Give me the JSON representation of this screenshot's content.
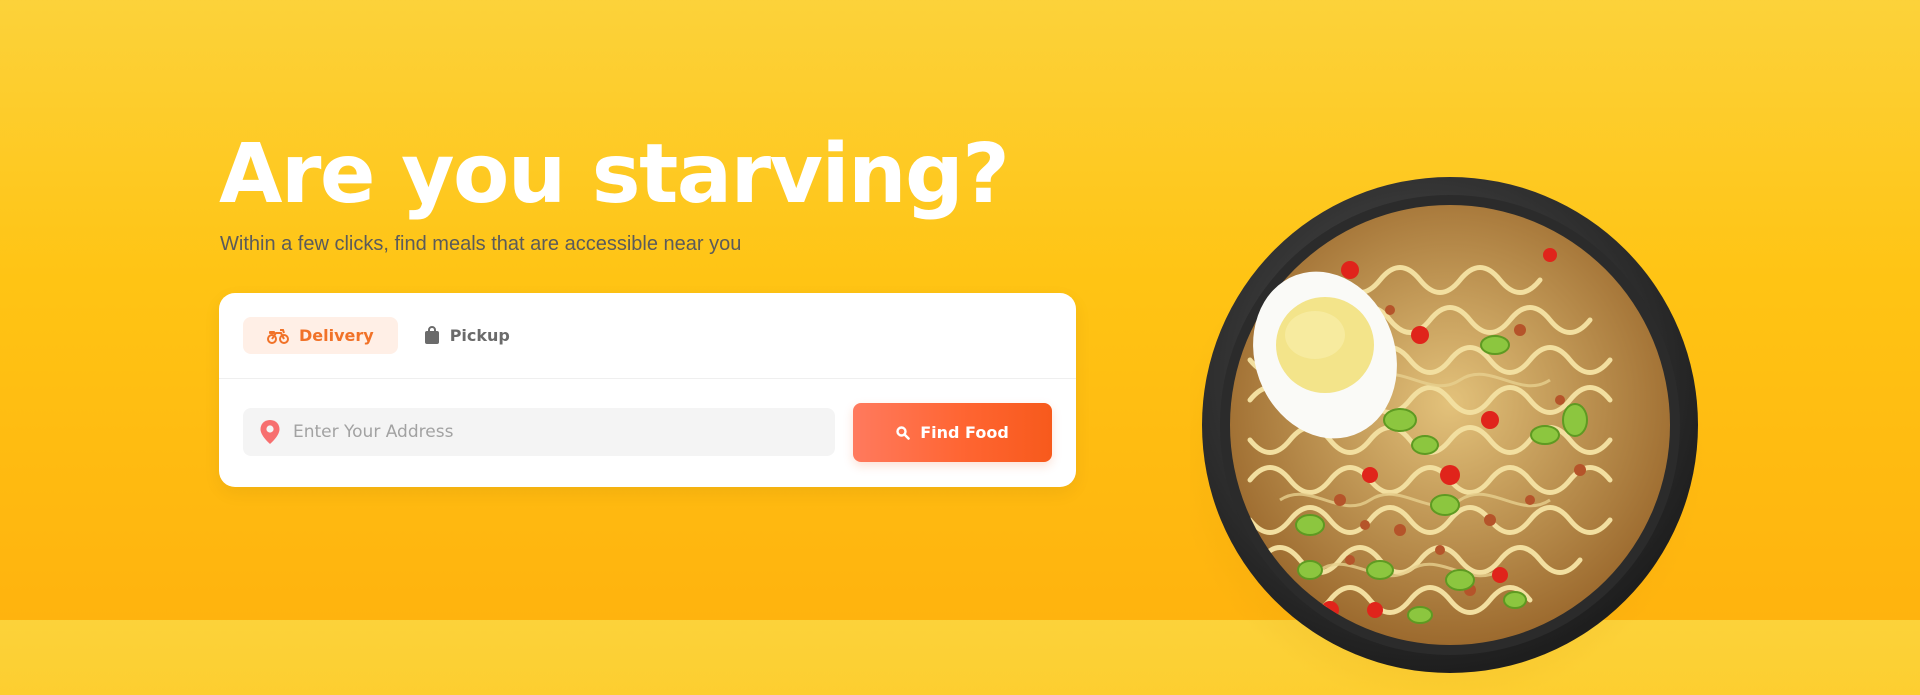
{
  "hero": {
    "title": "Are you starving?",
    "subtitle": "Within a few clicks, find meals that are accessible near you"
  },
  "search": {
    "tabs": [
      {
        "label": "Delivery",
        "icon": "motorcycle-icon",
        "active": true
      },
      {
        "label": "Pickup",
        "icon": "shopping-bag-icon",
        "active": false
      }
    ],
    "address_placeholder": "Enter Your Address",
    "address_value": "",
    "find_label": "Find Food",
    "find_icon": "search-icon"
  },
  "image": {
    "subject": "bowl-of-ramen-noodles",
    "icon": "food-image"
  },
  "colors": {
    "accent": "#F17228",
    "accent_soft": "#FFEFE6",
    "button_start": "#FF7A5E",
    "button_end": "#F75A1C",
    "background_top": "#FCD23A",
    "background_bottom": "#FFB30E"
  }
}
